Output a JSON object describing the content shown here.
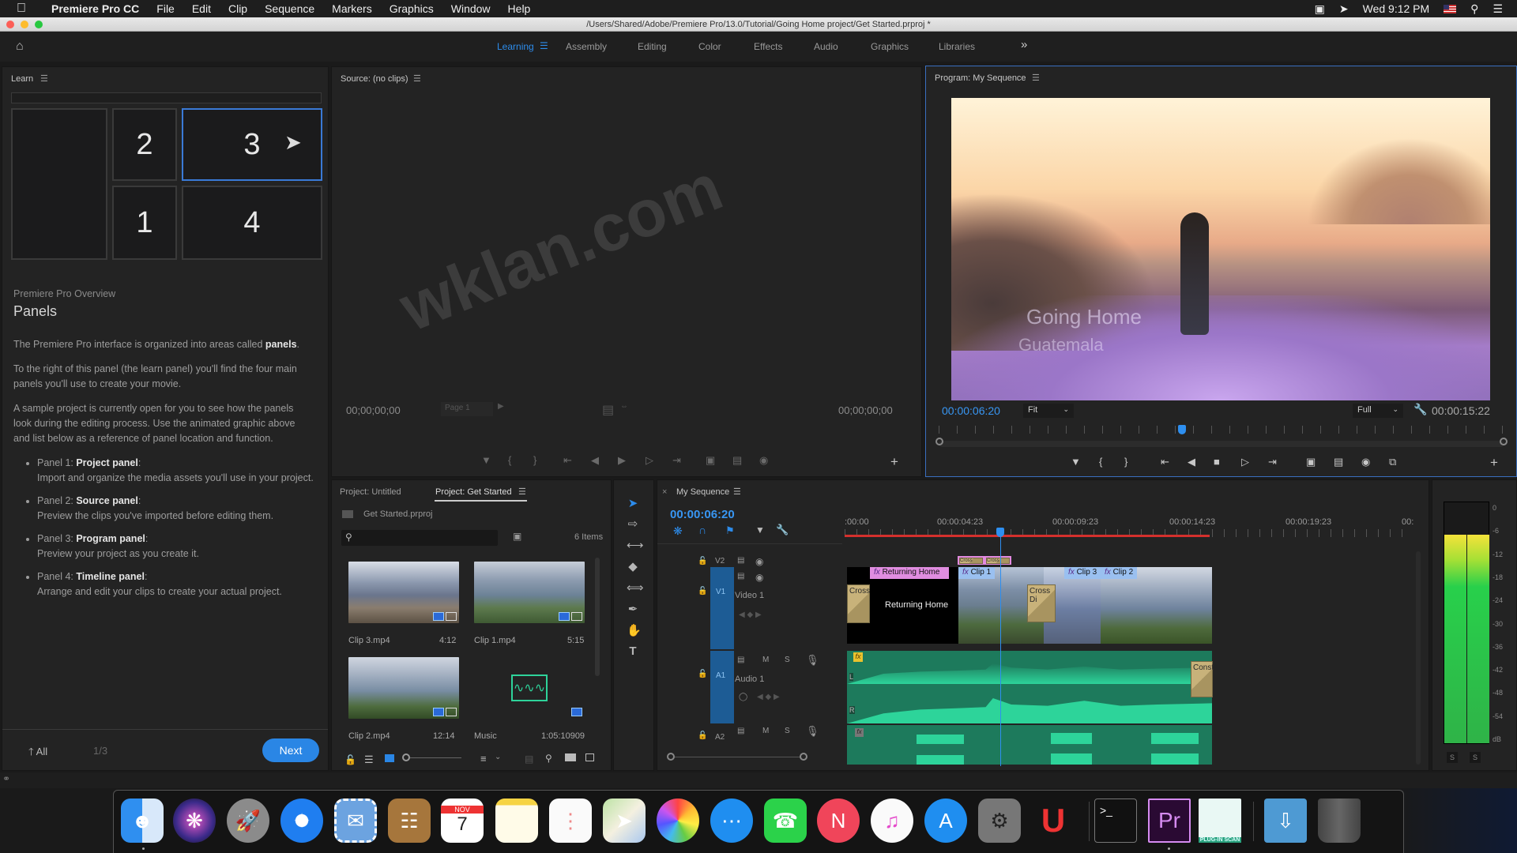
{
  "menubar": {
    "app": "Premiere Pro CC",
    "items": [
      "File",
      "Edit",
      "Clip",
      "Sequence",
      "Markers",
      "Graphics",
      "Window",
      "Help"
    ],
    "clock": "Wed 9:12 PM"
  },
  "window": {
    "title": "/Users/Shared/Adobe/Premiere Pro/13.0/Tutorial/Going Home project/Get Started.prproj *"
  },
  "workspaces": {
    "tabs": [
      "Learning",
      "Assembly",
      "Editing",
      "Color",
      "Effects",
      "Audio",
      "Graphics",
      "Libraries"
    ],
    "active": "Learning",
    "overflow": "»"
  },
  "learn": {
    "title": "Learn",
    "diagram_numbers": [
      "2",
      "3",
      "1",
      "4"
    ],
    "kicker": "Premiere Pro Overview",
    "heading": "Panels",
    "p1_pre": "The Premiere Pro interface is organized into areas called ",
    "p1_bold": "panels",
    "p1_post": ".",
    "p2": "To the right of this panel (the learn panel) you'll find the four main panels you'll use to create your movie.",
    "p3": "A sample project is currently open for you to see how the panels look during the editing process. Use the animated graphic above and list below as a reference of panel location and function.",
    "items": [
      {
        "prefix": "Panel 1: ",
        "name": "Project panel",
        "desc": "Import and organize the media assets you'll use in your project."
      },
      {
        "prefix": "Panel 2: ",
        "name": "Source panel",
        "desc": "Preview the clips you've imported before editing them."
      },
      {
        "prefix": "Panel 3: ",
        "name": "Program panel",
        "desc": "Preview your project as you create it."
      },
      {
        "prefix": "Panel 4: ",
        "name": "Timeline panel",
        "desc": "Arrange and edit your clips to create your actual project."
      }
    ],
    "all_label": "All",
    "page": "1/3",
    "next_label": "Next"
  },
  "source": {
    "title": "Source: (no clips)",
    "tc_in": "00;00;00;00",
    "tc_out": "00;00;00;00",
    "page_select": "Page 1",
    "watermark": "wklan.com"
  },
  "program": {
    "title": "Program: My Sequence",
    "timecode": "00:00:06:20",
    "fit": "Fit",
    "quality": "Full",
    "duration": "00:00:15:22",
    "overlay_line1": "Going Home",
    "overlay_line2": "Guatemala",
    "playhead_fraction": 0.43
  },
  "project": {
    "tabs": [
      "Project: Untitled",
      "Project: Get Started"
    ],
    "active_tab": "Project: Get Started",
    "file": "Get Started.prproj",
    "search_placeholder": "",
    "count": "6 Items",
    "items": [
      {
        "name": "Clip 3.mp4",
        "duration": "4:12"
      },
      {
        "name": "Clip 1.mp4",
        "duration": "5:15"
      },
      {
        "name": "Clip 2.mp4",
        "duration": "12:14"
      },
      {
        "name": "Music",
        "duration": "1:05:10909"
      }
    ]
  },
  "timeline": {
    "title": "My Sequence",
    "timecode": "00:00:06:20",
    "ruler": [
      ":00:00",
      "00:00:04:23",
      "00:00:09:23",
      "00:00:14:23",
      "00:00:19:23",
      "00:"
    ],
    "tracks": {
      "v2": "V2",
      "v1": "V1",
      "v1_name": "Video 1",
      "a1": "A1",
      "a1_name": "Audio 1",
      "a2": "A2",
      "m": "M",
      "s": "S"
    },
    "clips": {
      "title_clip": "Returning Home",
      "title_text": "Returning Home",
      "clip1": "Clip 1",
      "clip3": "Clip 3",
      "clip2": "Clip 2",
      "cross1": "Cross",
      "cross2": "Cross Di",
      "cross_v2a": "Cross",
      "cross_v2b": "Cross",
      "audio_trans": "Const",
      "fx": "fx",
      "chan_l": "L",
      "chan_r": "R"
    }
  },
  "meters": {
    "ticks": [
      "0",
      "-6",
      "-12",
      "-18",
      "-24",
      "-30",
      "-36",
      "-42",
      "-48",
      "-54",
      "dB"
    ],
    "solo": [
      "S",
      "S"
    ],
    "level_db": -6
  },
  "dock": {
    "apps": [
      "Finder",
      "Siri",
      "Launchpad",
      "Safari",
      "Mail",
      "Contacts",
      "Calendar",
      "Notes",
      "Reminders",
      "Maps",
      "Photos",
      "Messages",
      "FaceTime",
      "News",
      "iTunes",
      "App Store",
      "System Preferences",
      "Magnet",
      "Terminal",
      "Premiere Pro",
      "Plug-in Scan",
      "Downloads",
      "Trash"
    ],
    "calendar_month": "NOV",
    "calendar_day": "7",
    "pr_label": "Pr",
    "plugin_label": "PLUG-IN SCAN",
    "terminal_label": ">_"
  }
}
